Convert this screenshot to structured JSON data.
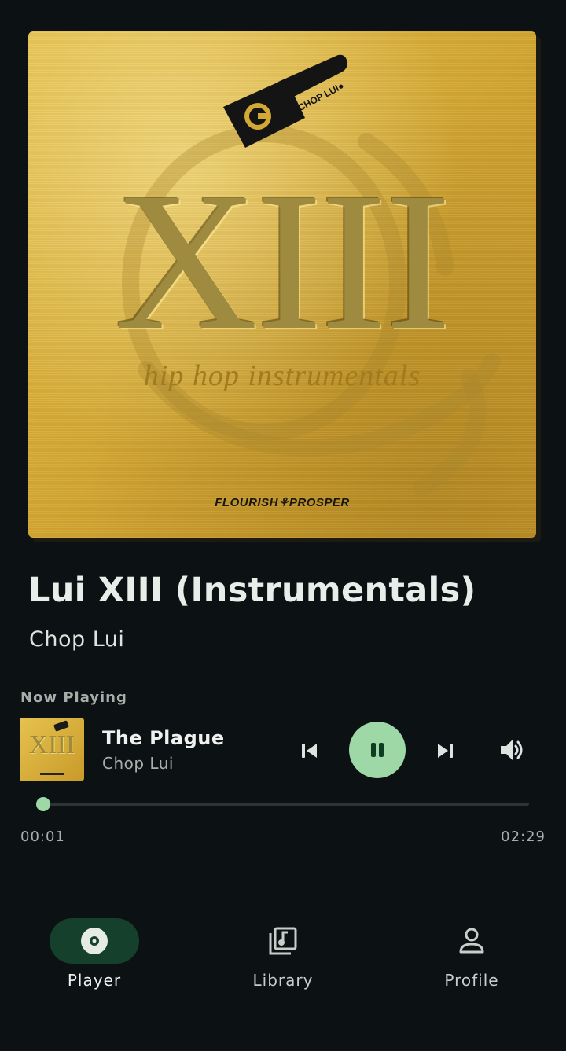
{
  "album": {
    "cover_main_text": "XIII",
    "cover_subtitle": "hip hop instrumentals",
    "cover_brand": "FLOURISH⚘PROSPER",
    "cover_logo_text": "CHOP LUI●",
    "title": "Lui XIII (Instrumentals)",
    "artist": "Chop Lui"
  },
  "now_playing": {
    "label": "Now Playing",
    "thumb_text": "XIII",
    "track_title": "The Plague",
    "track_artist": "Chop Lui",
    "is_playing": true,
    "current_time": "00:01",
    "total_time": "02:29",
    "progress": 0.007
  },
  "controls": {
    "previous_icon": "skip-previous-icon",
    "pause_icon": "pause-icon",
    "next_icon": "skip-next-icon",
    "volume_icon": "volume-up-icon"
  },
  "nav": {
    "items": [
      {
        "label": "Player",
        "icon": "disc-icon",
        "active": true
      },
      {
        "label": "Library",
        "icon": "music-library-icon",
        "active": false
      },
      {
        "label": "Profile",
        "icon": "person-icon",
        "active": false
      }
    ]
  },
  "colors": {
    "background": "#0c1114",
    "accent": "#9ed8a6",
    "nav_active_pill": "#15402c"
  }
}
